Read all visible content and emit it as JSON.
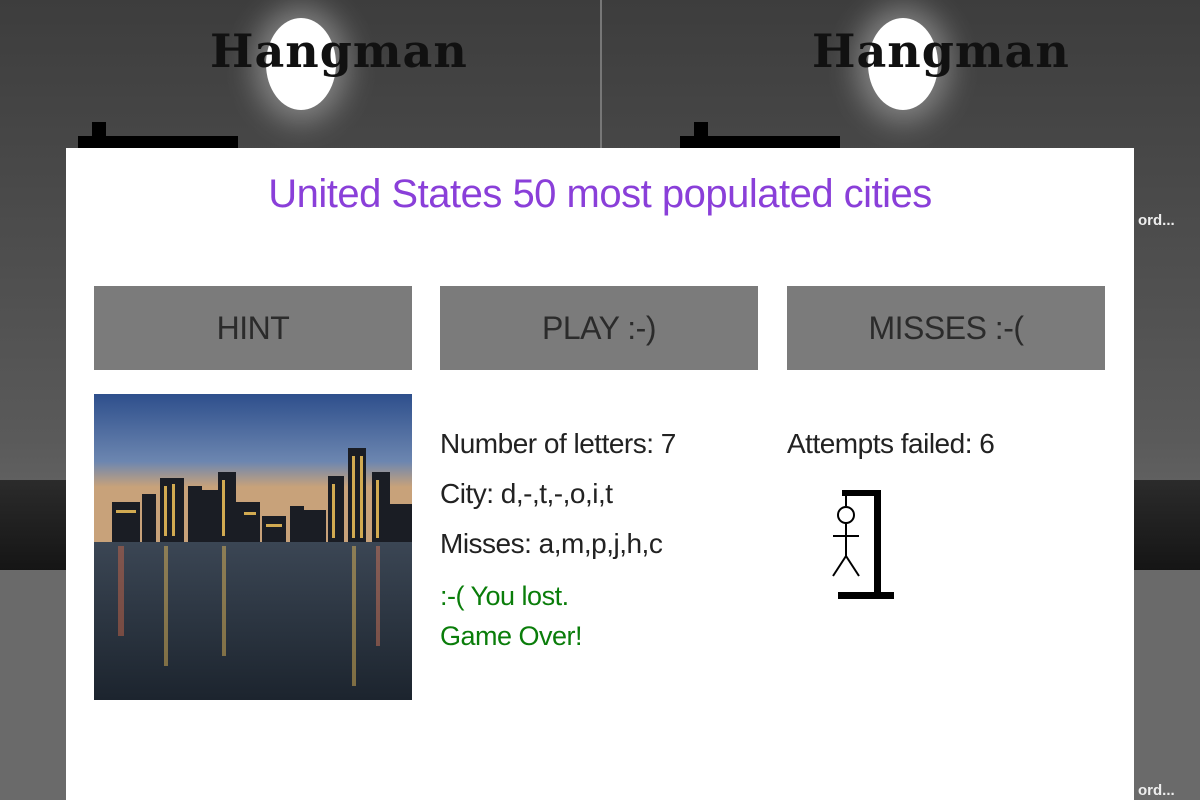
{
  "background": {
    "left_logo": "Hangman",
    "right_logo": "Hangman",
    "right_word_top": "ord...",
    "right_word_bottom": "ord..."
  },
  "modal": {
    "title": "United States 50 most populated cities",
    "buttons": {
      "hint": "HINT",
      "play": "PLAY :-)",
      "misses": "MISSES :-("
    },
    "hint_image": "city-skyline-photo",
    "info": {
      "letters": "Number of letters: 7",
      "city": "City: d,-,t,-,o,i,t",
      "misses": "Misses: a,m,p,j,h,c",
      "lost_line1": ":-( You lost.",
      "lost_line2": "Game Over!"
    },
    "attempts": "Attempts failed: 6"
  },
  "colors": {
    "title": "#8a3fd9",
    "button_bg": "#7b7b7b",
    "lost_text": "#0a7d0a"
  }
}
